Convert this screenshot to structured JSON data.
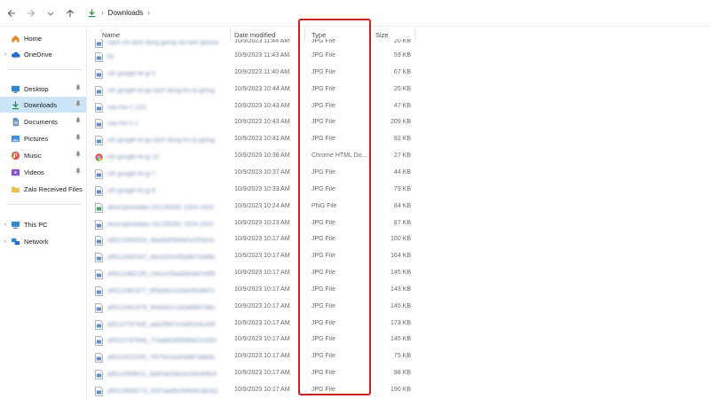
{
  "address": {
    "path": [
      "Downloads"
    ],
    "back_label": "Back",
    "forward_label": "Forward",
    "up_label": "Up"
  },
  "sidebar": {
    "items": [
      {
        "label": "Home",
        "icon": "home-icon",
        "expandable": false,
        "pinned": false,
        "active": false
      },
      {
        "label": "OneDrive",
        "icon": "cloud-icon",
        "expandable": true,
        "pinned": false,
        "active": false
      },
      {
        "label": "Desktop",
        "icon": "desktop-icon",
        "expandable": false,
        "pinned": true,
        "active": false
      },
      {
        "label": "Downloads",
        "icon": "download-icon",
        "expandable": false,
        "pinned": true,
        "active": true
      },
      {
        "label": "Documents",
        "icon": "document-icon",
        "expandable": false,
        "pinned": true,
        "active": false
      },
      {
        "label": "Pictures",
        "icon": "pictures-icon",
        "expandable": false,
        "pinned": true,
        "active": false
      },
      {
        "label": "Music",
        "icon": "music-icon",
        "expandable": false,
        "pinned": true,
        "active": false
      },
      {
        "label": "Videos",
        "icon": "videos-icon",
        "expandable": false,
        "pinned": true,
        "active": false
      },
      {
        "label": "Zalo Received Files",
        "icon": "folder-icon",
        "expandable": false,
        "pinned": false,
        "active": false
      },
      {
        "label": "This PC",
        "icon": "pc-icon",
        "expandable": true,
        "pinned": false,
        "active": false
      },
      {
        "label": "Network",
        "icon": "network-icon",
        "expandable": true,
        "pinned": false,
        "active": false
      }
    ]
  },
  "columns": {
    "name": "Name",
    "date": "Date modified",
    "type": "Type",
    "size": "Size"
  },
  "files": [
    {
      "name": "cach chi dinh dung giong noi tren iphone",
      "date": "10/9/2023 11:44 AM",
      "type": "JPG File",
      "size": "20 KB",
      "icon": "jpg-file-icon"
    },
    {
      "name": "tts",
      "date": "10/9/2023 11:43 AM",
      "type": "JPG File",
      "size": "59 KB",
      "icon": "jpg-file-icon"
    },
    {
      "name": "cth google-te-gi 5",
      "date": "10/9/2023 11:40 AM",
      "type": "JPG File",
      "size": "67 KB",
      "icon": "jpg-file-icon"
    },
    {
      "name": "cth google-te-gi-cach-dung-tro-ly-giong",
      "date": "10/9/2023 10:44 AM",
      "type": "JPG File",
      "size": "25 KB",
      "icon": "jpg-file-icon"
    },
    {
      "name": "cau-hoi-1 (12)",
      "date": "10/9/2023 10:43 AM",
      "type": "JPG File",
      "size": "47 KB",
      "icon": "jpg-file-icon"
    },
    {
      "name": "cau-hoi-1 1",
      "date": "10/9/2023 10:43 AM",
      "type": "JPG File",
      "size": "209 KB",
      "icon": "jpg-file-icon"
    },
    {
      "name": "cth google-te-gi-cach-dung-tro-ly-giong",
      "date": "10/9/2023 10:41 AM",
      "type": "JPG File",
      "size": "92 KB",
      "icon": "jpg-file-icon"
    },
    {
      "name": "cth google-te-gi 12",
      "date": "10/9/2023 10:38 AM",
      "type": "Chrome HTML Do...",
      "size": "27 KB",
      "icon": "chrome-html-icon"
    },
    {
      "name": "cth google-te-gi 7",
      "date": "10/9/2023 10:37 AM",
      "type": "JPG File",
      "size": "44 KB",
      "icon": "jpg-file-icon"
    },
    {
      "name": "cth google-te-gi 8",
      "date": "10/9/2023 10:33 AM",
      "type": "JPG File",
      "size": "79 KB",
      "icon": "jpg-file-icon"
    },
    {
      "name": "descriptivedata 151230291 1024-1024",
      "date": "10/9/2023 10:24 AM",
      "type": "PNG File",
      "size": "84 KB",
      "icon": "png-file-icon"
    },
    {
      "name": "descriptivedata 151230291 1024-1024",
      "date": "10/9/2023 10:23 AM",
      "type": "JPG File",
      "size": "87 KB",
      "icon": "jpg-file-icon"
    },
    {
      "name": "af9112483418_4ba3a0f3e8af1e2f3a1b",
      "date": "10/9/2023 10:17 AM",
      "type": "JPG File",
      "size": "100 KB",
      "icon": "jpg-file-icon"
    },
    {
      "name": "af9112482347_4bcd1f2e4f5a6b7c8d9e",
      "date": "10/9/2023 10:17 AM",
      "type": "JPG File",
      "size": "164 KB",
      "icon": "jpg-file-icon"
    },
    {
      "name": "af9112482235_c0d1e2f3a4b5c6d7e8f9",
      "date": "10/9/2023 10:17 AM",
      "type": "JPG File",
      "size": "145 KB",
      "icon": "jpg-file-icon"
    },
    {
      "name": "af9112481977_8f9a0b1c2d3e4f5a6b7c",
      "date": "10/9/2023 10:17 AM",
      "type": "JPG File",
      "size": "143 KB",
      "icon": "jpg-file-icon"
    },
    {
      "name": "af9112481978_9f4d3e2c1b0a9f8e7d6c",
      "date": "10/9/2023 10:17 AM",
      "type": "JPG File",
      "size": "145 KB",
      "icon": "jpg-file-icon"
    },
    {
      "name": "af9110797635_aab2f6d7e2a8f1b3c4d5",
      "date": "10/9/2023 10:17 AM",
      "type": "JPG File",
      "size": "173 KB",
      "icon": "jpg-file-icon"
    },
    {
      "name": "af9110797644_77aabb200589af1e2d3c",
      "date": "10/9/2023 10:17 AM",
      "type": "JPG File",
      "size": "145 KB",
      "icon": "jpg-file-icon"
    },
    {
      "name": "af9110511055_7f575e1b4e5d6f7a8b9c",
      "date": "10/9/2023 10:17 AM",
      "type": "JPG File",
      "size": "75 KB",
      "icon": "jpg-file-icon"
    },
    {
      "name": "af9110508011_8a92ae04b2a1f3e4d5c6",
      "date": "10/9/2023 10:17 AM",
      "type": "JPG File",
      "size": "98 KB",
      "icon": "jpg-file-icon"
    },
    {
      "name": "af9110508173_0c67aa0bc0e5d4c3b2a1",
      "date": "10/9/2023 10:17 AM",
      "type": "JPG File",
      "size": "190 KB",
      "icon": "jpg-file-icon"
    }
  ],
  "annotation": {
    "color": "#cc1f1f"
  }
}
